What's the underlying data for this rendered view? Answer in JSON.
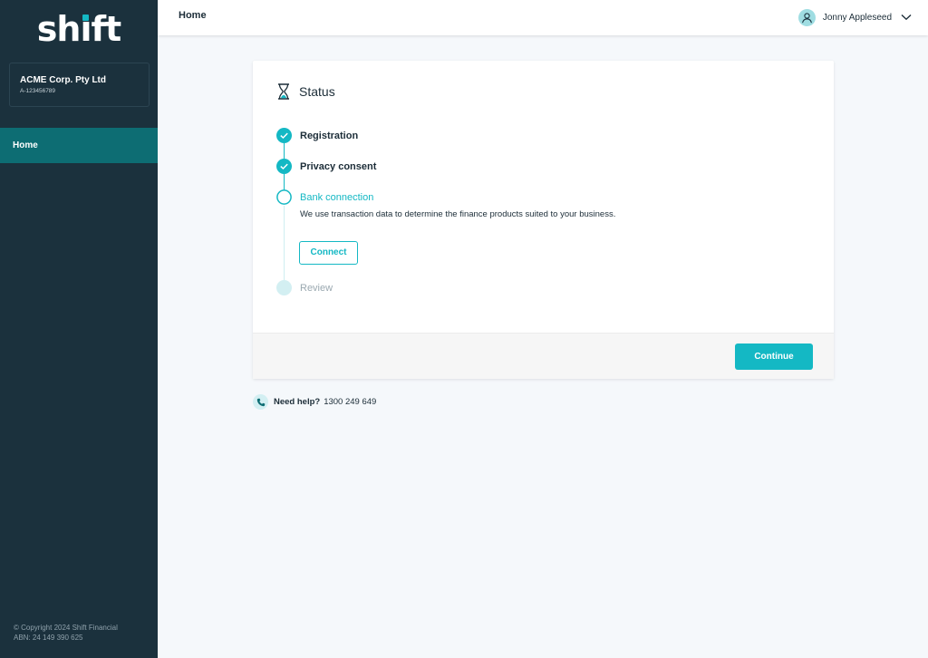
{
  "brand": {
    "logo_text": "shift",
    "accent": "#14b8c4",
    "sidebar_bg": "#1b313d",
    "nav_active_bg": "#0d6d73"
  },
  "org": {
    "name": "ACME Corp. Pty Ltd",
    "id": "A-123456789"
  },
  "nav": {
    "home": "Home"
  },
  "footer": {
    "copyright": "© Copyright 2024 Shift Financial",
    "abn": "ABN: 24 149 390 625"
  },
  "header": {
    "title": "Home",
    "user_name": "Jonny Appleseed",
    "avatar_icon": "user-icon",
    "menu_icon": "chevron-down-icon"
  },
  "status": {
    "title": "Status",
    "icon": "hourglass-icon",
    "steps": [
      {
        "label": "Registration",
        "state": "complete"
      },
      {
        "label": "Privacy consent",
        "state": "complete"
      },
      {
        "label": "Bank connection",
        "state": "active",
        "description": "We use transaction data to determine the finance products suited to your business.",
        "action_label": "Connect"
      },
      {
        "label": "Review",
        "state": "pending"
      }
    ],
    "continue_label": "Continue"
  },
  "help": {
    "icon": "phone-icon",
    "label": "Need help?",
    "number": "1300 249 649"
  }
}
